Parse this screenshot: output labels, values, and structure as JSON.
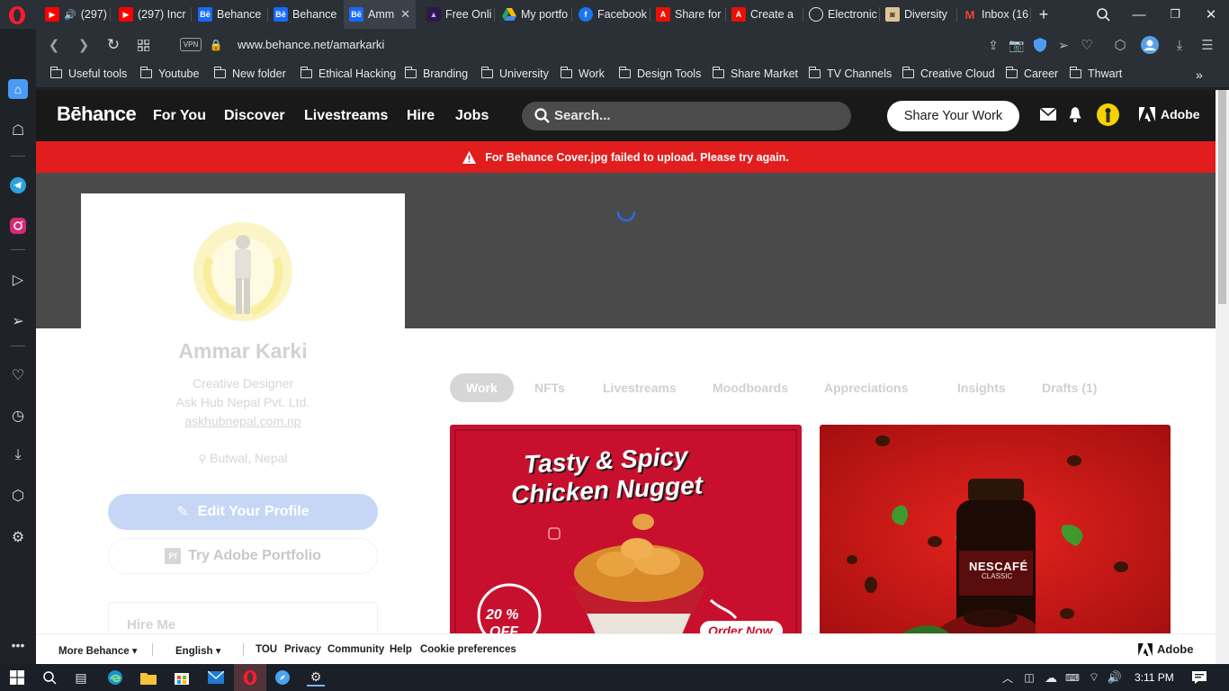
{
  "browser": {
    "tabs": [
      {
        "title": "(297)",
        "icon": "youtube-icon",
        "color": "#ff0000"
      },
      {
        "title": "(297) Incr",
        "icon": "youtube-icon",
        "color": "#ff0000"
      },
      {
        "title": "Behance",
        "icon": "behance-icon",
        "color": "#1769ff"
      },
      {
        "title": "Behance",
        "icon": "behance-icon",
        "color": "#1769ff"
      },
      {
        "title": "Amm",
        "icon": "behance-icon",
        "color": "#1769ff",
        "active": true
      },
      {
        "title": "Free Onli",
        "icon": "app-icon",
        "color": "#6b2cf5"
      },
      {
        "title": "My portfo",
        "icon": "google-drive-icon",
        "color": "#1fa463"
      },
      {
        "title": "Facebook",
        "icon": "facebook-icon",
        "color": "#1877f2"
      },
      {
        "title": "Share for",
        "icon": "adobe-icon",
        "color": "#eb1000"
      },
      {
        "title": "Create a",
        "icon": "adobe-icon",
        "color": "#eb1000"
      },
      {
        "title": "Electronic",
        "icon": "globe-icon",
        "color": "#e8eaed"
      },
      {
        "title": "Diversity",
        "icon": "page-icon",
        "color": "#c9a86b"
      },
      {
        "title": "Inbox (16",
        "icon": "gmail-icon",
        "color": "#ea4335"
      }
    ],
    "url": "www.behance.net/amarkarki",
    "vpn_label": "VPN",
    "bookmarks": [
      "Useful tools",
      "Youtube",
      "New folder",
      "Ethical Hacking",
      "Branding",
      "University",
      "Work",
      "Design Tools",
      "Share Market",
      "TV  Channels",
      "Creative Cloud",
      "Career",
      "Thwart"
    ]
  },
  "behance": {
    "logo": "Bēhance",
    "nav": {
      "for_you": "For You",
      "discover": "Discover",
      "livestreams": "Livestreams",
      "hire": "Hire",
      "jobs": "Jobs"
    },
    "search_placeholder": "Search...",
    "share_button": "Share Your Work",
    "adobe_label": "Adobe",
    "error_message": "For Behance Cover.jpg failed to upload. Please try again.",
    "profile": {
      "name": "Ammar Karki",
      "title": "Creative Designer",
      "company": "Ask Hub Nepal Pvt. Ltd.",
      "website": "askhubnepal.com.np",
      "location": "Butwal, Nepal",
      "edit_button": "Edit Your Profile",
      "portfolio_badge": "Pf",
      "portfolio_button": "Try Adobe Portfolio",
      "hire_me": "Hire Me"
    },
    "tabs": [
      "Work",
      "NFTs",
      "Livestreams",
      "Moodboards",
      "Appreciations",
      "Insights",
      "Drafts (1)"
    ],
    "active_tab": "Work",
    "projects": [
      {
        "headline_1": "Tasty & Spicy",
        "headline_2": "Chicken Nugget",
        "badge": "20 %",
        "badge_2": "OFF",
        "cta": "Order Now"
      },
      {
        "brand": "NESCAFÉ",
        "sub": "CLASSIC"
      }
    ],
    "footer": {
      "more": "More Behance",
      "language": "English",
      "links": [
        "TOU",
        "Privacy",
        "Community",
        "Help",
        "Cookie preferences"
      ],
      "adobe": "Adobe"
    }
  },
  "taskbar": {
    "time": "3:11 PM"
  },
  "colors": {
    "accent_blue": "#1769ff",
    "error_red": "#e21d1d",
    "nav_dark": "#191919"
  }
}
